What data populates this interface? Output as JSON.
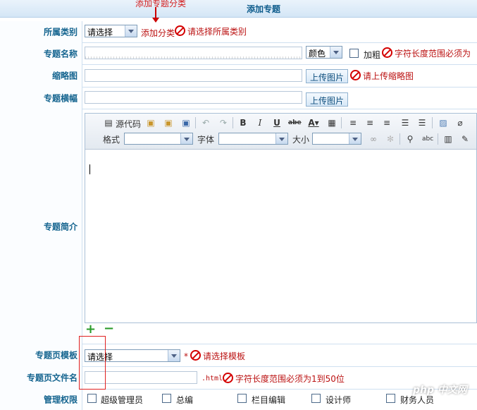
{
  "header": {
    "title": "添加专题",
    "annotation": "添加专题分类"
  },
  "rows": {
    "category": {
      "label": "所属类别",
      "select_value": "请选择",
      "add_link": "添加分类",
      "error": "请选择所属类别"
    },
    "name": {
      "label": "专题名称",
      "color_select": "颜色",
      "bold_label": "加粗",
      "error": "字符长度范围必须为"
    },
    "thumb": {
      "label": "缩略图",
      "upload": "上传图片",
      "error": "请上传缩略图"
    },
    "banner": {
      "label": "专题横幅",
      "upload": "上传图片"
    },
    "intro": {
      "label": "专题简介"
    },
    "template": {
      "label": "专题页模板",
      "select_value": "请选择",
      "required": "*",
      "error": "请选择模板"
    },
    "filename": {
      "label": "专题页文件名",
      "suffix": ".html",
      "error": "字符长度范围必须为1到50位"
    },
    "perm": {
      "label": "管理权限",
      "roles": [
        "超级管理员",
        "总编",
        "栏目编辑",
        "设计师",
        "财务人员"
      ]
    }
  },
  "editor": {
    "source_label": "源代码",
    "format_label": "格式",
    "font_label": "字体",
    "size_label": "大小",
    "icons": [
      "source-icon",
      "paste-icon",
      "paste-text-icon",
      "paste-word-icon",
      "undo-icon",
      "redo-icon",
      "bold-icon",
      "italic-icon",
      "underline-icon",
      "strike-icon",
      "text-color-icon",
      "table-icon",
      "align-left-icon",
      "align-center-icon",
      "align-right-icon",
      "ordered-list-icon",
      "unordered-list-icon",
      "image-icon",
      "attach-icon",
      "link-icon",
      "unlink-icon",
      "find-icon",
      "spellcheck-icon",
      "media-icon",
      "eraser-icon"
    ]
  },
  "watermark": "php 中文网",
  "colors": {
    "label": "#14648f",
    "error": "#b11111",
    "border": "#cfe0f0"
  }
}
